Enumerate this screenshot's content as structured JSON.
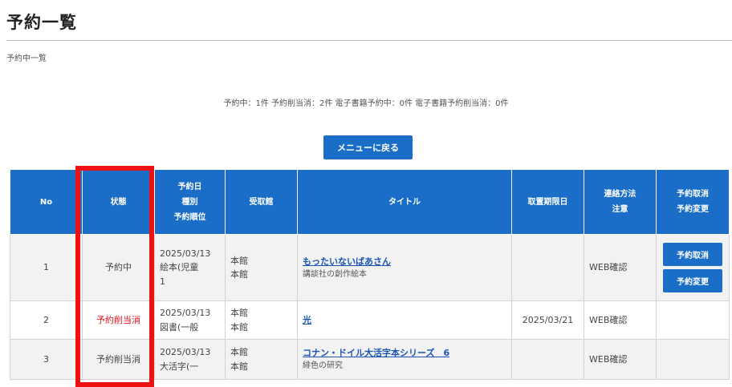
{
  "page": {
    "title": "予約一覧",
    "subhead": "予約中一覧",
    "summary": "予約中：1件 予約削当消：2件 電子書籍予約中：0件 電子書籍予約削当消：0件",
    "menu_button": "メニューに戻る"
  },
  "table": {
    "headers": {
      "no": "No",
      "status": "状態",
      "date_1": "予約日",
      "date_2": "種別",
      "date_3": "予約順位",
      "branch": "受取館",
      "title": "タイトル",
      "deadline": "取置期限日",
      "contact_1": "連絡方法",
      "contact_2": "注意",
      "action_1": "予約取消",
      "action_2": "予約変更"
    },
    "rows": [
      {
        "no": "1",
        "status": "予約中",
        "date": "2025/03/13",
        "type": "絵本(児童",
        "rank": "1",
        "branch_1": "本館",
        "branch_2": "本館",
        "title": "もったいないばあさん",
        "subtitle": "講談社の創作絵本",
        "deadline": "",
        "contact": "WEB確認",
        "btn_cancel": "予約取消",
        "btn_change": "予約変更"
      },
      {
        "no": "2",
        "status": "予約削当消",
        "date": "2025/03/13",
        "type": "図書(一般",
        "branch_1": "本館",
        "branch_2": "本館",
        "title": "光",
        "deadline": "2025/03/21",
        "contact": "WEB確認"
      },
      {
        "no": "3",
        "status": "予約削当消",
        "date": "2025/03/13",
        "type": "大活字(一",
        "branch_1": "本館",
        "branch_2": "本館",
        "title": "コナン・ドイル大活字本シリーズ　6",
        "subtitle": "緋色の研究",
        "deadline": "",
        "contact": "WEB確認"
      }
    ]
  },
  "colors": {
    "accent": "#1a6ec8",
    "status_red": "#e8151b",
    "highlight": "#ee1111",
    "link": "#1a55b5"
  }
}
